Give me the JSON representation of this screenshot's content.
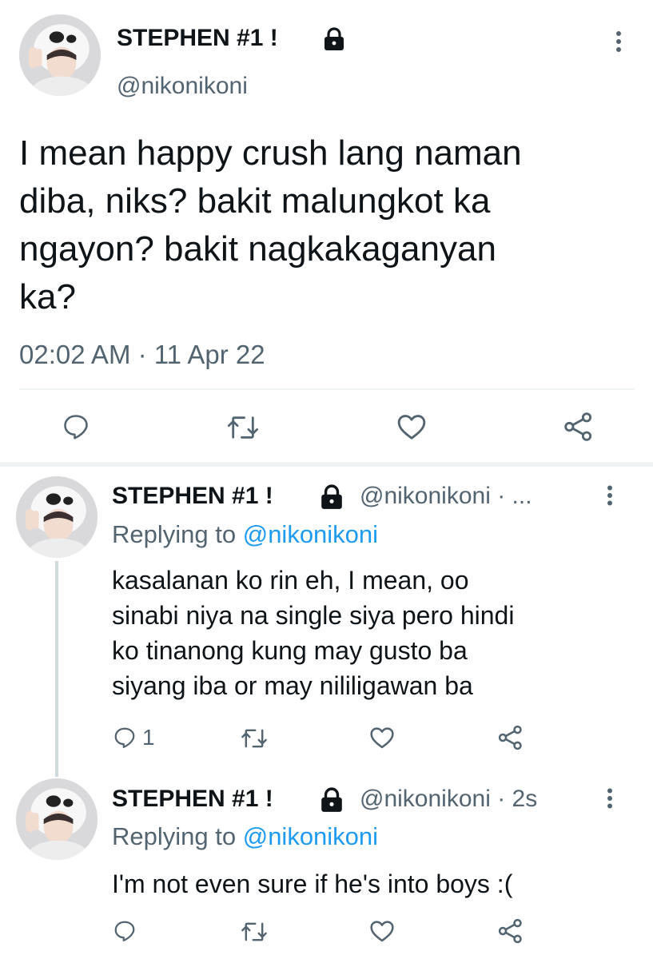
{
  "main_tweet": {
    "display_name": "STEPHEN #1 !",
    "handle": "@nikonikoni",
    "text_lines": [
      "I mean happy crush lang naman",
      "diba, niks? bakit malungkot ka",
      "ngayon? bakit nagkakaganyan",
      "ka?"
    ],
    "timestamp": "02:02 AM · 11 Apr 22",
    "icons": [
      "reply-icon",
      "retweet-icon",
      "like-icon",
      "share-icon",
      "lock-icon",
      "more-icon"
    ]
  },
  "replies": [
    {
      "display_name": "STEPHEN #1 !",
      "handle_time": "@nikonikoni · ...",
      "replying_prefix": "Replying to ",
      "replying_to": "@nikonikoni",
      "text_lines": [
        "kasalanan ko rin eh, I mean, oo",
        "sinabi niya na single siya pero hindi",
        "ko tinanong kung may gusto ba",
        "siyang iba or may nililigawan ba"
      ],
      "reply_count": "1"
    },
    {
      "display_name": "STEPHEN #1 !",
      "handle_time": "@nikonikoni · 2s",
      "replying_prefix": "Replying to ",
      "replying_to": "@nikonikoni",
      "text_lines": [
        "I'm not even sure if he's into boys :("
      ],
      "reply_count": ""
    }
  ],
  "colors": {
    "text": "#0f1419",
    "secondary": "#536471",
    "link": "#1d9bf0",
    "divider": "#eff3f4"
  }
}
